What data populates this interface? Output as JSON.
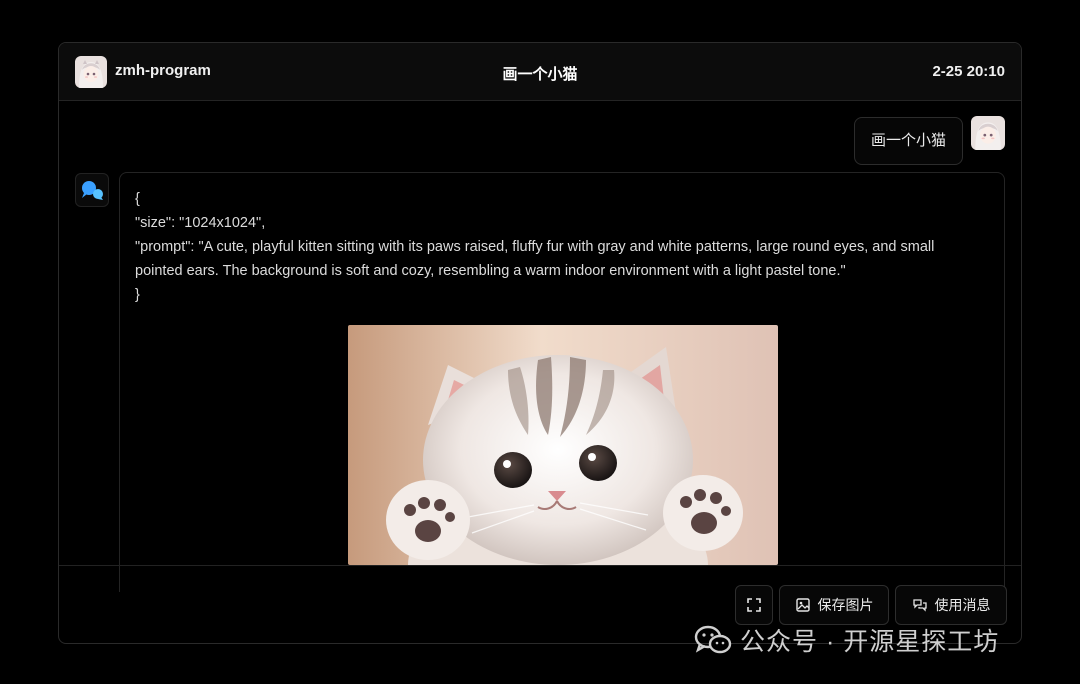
{
  "header": {
    "user_name": "zmh-program",
    "title": "画一个小猫",
    "time": "2-25 20:10"
  },
  "messages": {
    "user_text": "画一个小猫",
    "bot_lines": [
      "{",
      "\"size\": \"1024x1024\",",
      "\"prompt\": \"A cute, playful kitten sitting with its paws raised, fluffy fur with gray and white patterns, large round eyes, and small pointed ears. The background is soft and cozy, resembling a warm indoor environment with a light pastel tone.\"",
      "}"
    ]
  },
  "actions": {
    "fullscreen_icon": "fullscreen-icon",
    "save_image_label": "保存图片",
    "use_message_label": "使用消息"
  },
  "watermark": {
    "text": "公众号 · 开源星探工坊"
  },
  "colors": {
    "background": "#000000",
    "header_bg": "#0c0c0c",
    "border": "#2a2a2a",
    "text": "#e8e8e8",
    "bot_icon": "#3aa0ff"
  }
}
